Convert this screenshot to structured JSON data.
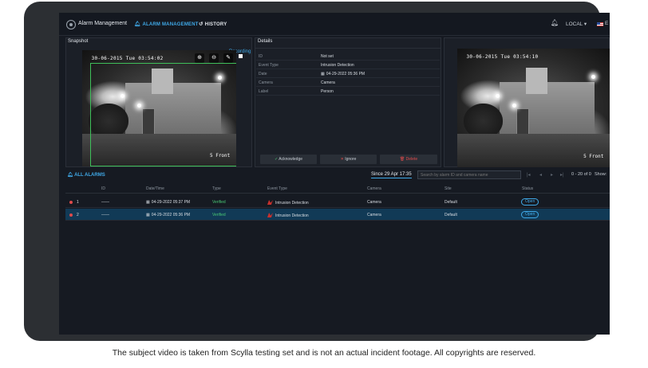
{
  "topbar": {
    "app_title": "Alarm Management",
    "nav": [
      {
        "label": "ALARM MANAGEMENT",
        "icon": "bell-icon",
        "active": true
      },
      {
        "label": "HISTORY",
        "icon": "history-icon",
        "active": false
      }
    ],
    "locale": "LOCAL",
    "language": "E"
  },
  "snapshot": {
    "title": "Snapshot",
    "recording_label": "Recording",
    "camera_timestamp": "30-06-2015 Tue 03:54:02",
    "camera_label": "5 Front",
    "tools": [
      "zoom-in-icon",
      "zoom-out-icon",
      "pen-icon"
    ]
  },
  "details": {
    "title": "Details",
    "rows": [
      {
        "key": "ID",
        "value": "Not set"
      },
      {
        "key": "Event Type",
        "value": "Intrusion Detection"
      },
      {
        "key": "Date",
        "value": "04-29-2022 05:36 PM"
      },
      {
        "key": "Camera",
        "value": "Camera"
      },
      {
        "key": "Label",
        "value": "Person"
      }
    ],
    "actions": {
      "acknowledge": "Acknowledge",
      "ignore": "Ignore",
      "delete": "Delete"
    }
  },
  "preview": {
    "camera_timestamp": "30-06-2015 Tue 03:54:10",
    "camera_label": "5 Front"
  },
  "alarms": {
    "tab_label": "ALL ALARMS",
    "since": "Since 29 Apr 17:35",
    "search_placeholder": "Search by alarm ID and camera name",
    "page_range": "0 - 20 of 0",
    "show_label": "Show:",
    "columns": [
      "ID",
      "Date/Time",
      "Type",
      "Event Type",
      "Camera",
      "Site",
      "Status"
    ],
    "rows": [
      {
        "index": "1",
        "id": "——",
        "datetime": "04-29-2022 05:37 PM",
        "type": "Verified",
        "event_type": "Intrusion Detection",
        "camera": "Camera",
        "site": "Default",
        "status": "Open",
        "selected": false
      },
      {
        "index": "2",
        "id": "——",
        "datetime": "04-29-2022 05:36 PM",
        "type": "Verified",
        "event_type": "Intrusion Detection",
        "camera": "Camera",
        "site": "Default",
        "status": "Open",
        "selected": true
      }
    ]
  },
  "caption": "The subject video is taken from Scylla testing set and is not an actual incident footage. All copyrights are reserved.",
  "colors": {
    "accent": "#3fa9e8",
    "verified": "#48c774",
    "alert": "#e04b4b",
    "selected_row": "#113a56"
  }
}
